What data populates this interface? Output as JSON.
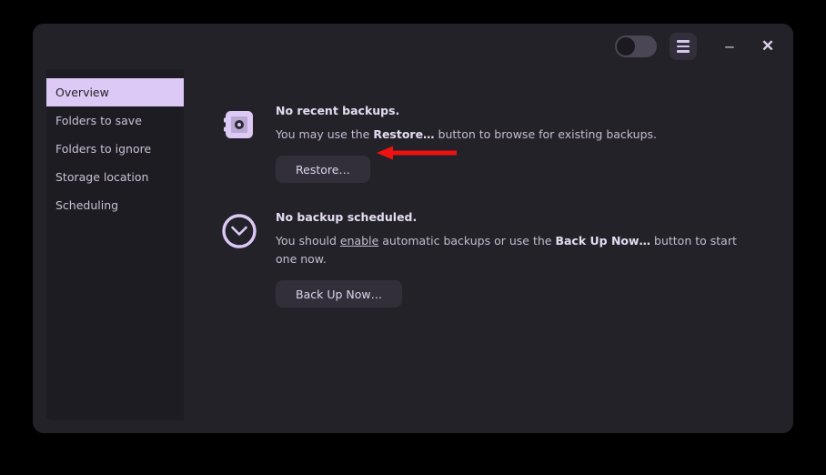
{
  "window": {
    "title": "",
    "titlebar": {
      "toggle": {
        "name": "power-toggle",
        "state": "off"
      },
      "menu_label": "☰",
      "minimize_label": "–",
      "close_label": "✕"
    }
  },
  "sidebar": {
    "items": [
      {
        "label": "Overview",
        "selected": true
      },
      {
        "label": "Folders to save",
        "selected": false
      },
      {
        "label": "Folders to ignore",
        "selected": false
      },
      {
        "label": "Storage location",
        "selected": false
      },
      {
        "label": "Scheduling",
        "selected": false
      }
    ]
  },
  "main": {
    "sections": [
      {
        "icon": "safe-icon",
        "title": "No recent backups.",
        "text_parts": {
          "pre": "You may use the ",
          "bold": "Restore…",
          "post": " button to browse for existing backups."
        },
        "button_label": "Restore…"
      },
      {
        "icon": "clock-icon",
        "title": "No backup scheduled.",
        "text_parts": {
          "pre": "You should ",
          "link": "enable",
          "mid": " automatic backups or use the ",
          "bold": "Back Up Now…",
          "post": " button to start one now."
        },
        "button_label": "Back Up Now…"
      }
    ]
  },
  "annotation": {
    "arrow_color": "#ee1111",
    "arrow_direction": "left",
    "points_at": "Restore…"
  },
  "colors": {
    "window_bg": "#242229",
    "sidebar_bg": "#1e1c23",
    "accent": "#dcc9f5",
    "button_bg": "#322f3a",
    "text": "#c3bccf",
    "page_bg": "#000000"
  }
}
